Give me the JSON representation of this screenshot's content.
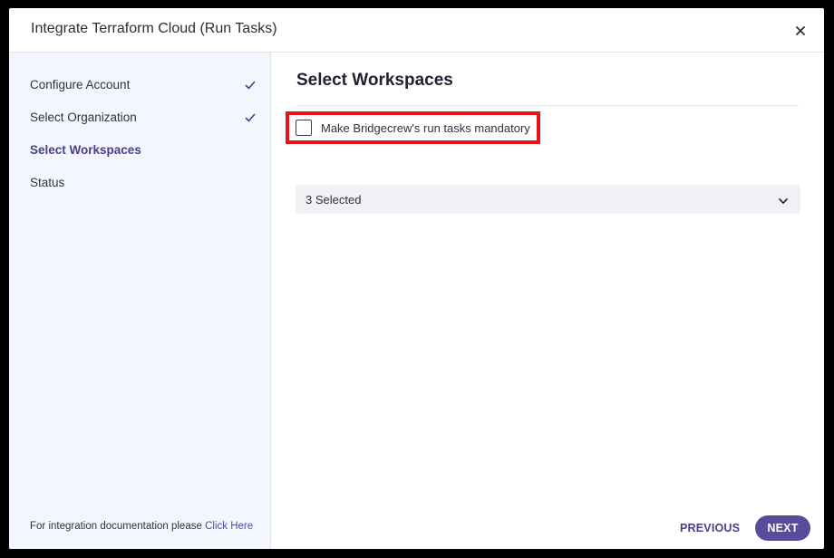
{
  "dialog": {
    "title": "Integrate Terraform Cloud (Run Tasks)",
    "close_icon": "close-icon"
  },
  "sidebar": {
    "steps": [
      {
        "label": "Configure Account",
        "completed": true,
        "active": false
      },
      {
        "label": "Select Organization",
        "completed": true,
        "active": false
      },
      {
        "label": "Select Workspaces",
        "completed": false,
        "active": true
      },
      {
        "label": "Status",
        "completed": false,
        "active": false
      }
    ],
    "doc_note": "For integration documentation please",
    "doc_link": "Click Here"
  },
  "main": {
    "title": "Select Workspaces",
    "mandatory_checkbox": {
      "label": "Make Bridgecrew's run tasks mandatory",
      "checked": false
    },
    "workspaces_select": {
      "value": "3 Selected"
    },
    "buttons": {
      "previous": "PREVIOUS",
      "next": "NEXT"
    }
  },
  "colors": {
    "accent": "#5a4a9c",
    "active_step": "#4c3d8a",
    "sidebar_bg": "#f3f6fd",
    "highlight": "#e5141b"
  }
}
